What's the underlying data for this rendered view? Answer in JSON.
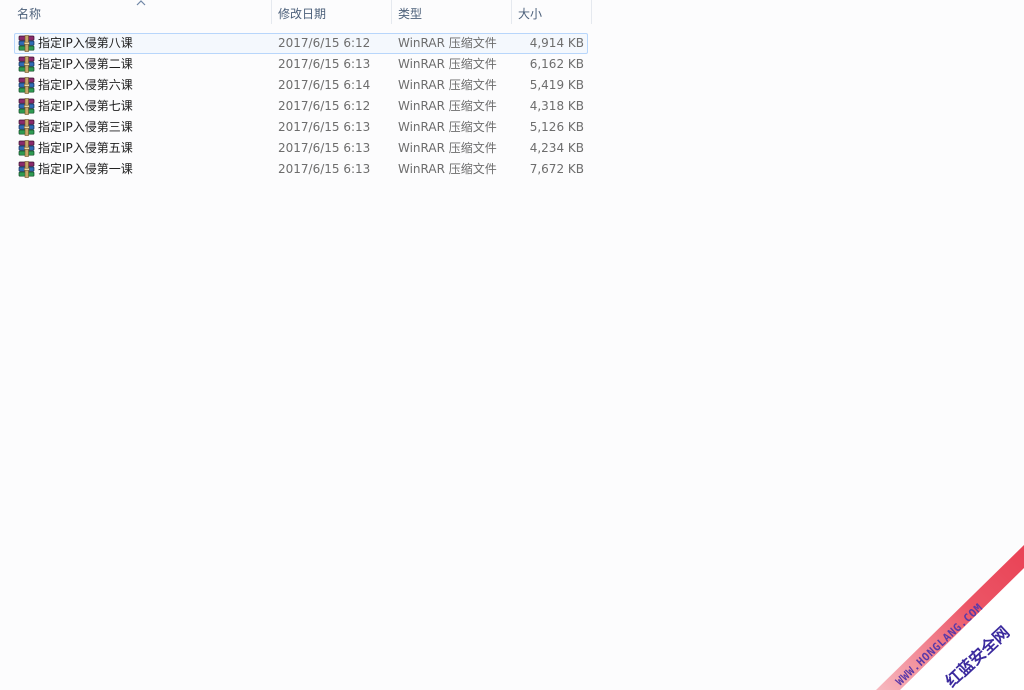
{
  "columns": {
    "name": "名称",
    "date": "修改日期",
    "type": "类型",
    "size": "大小"
  },
  "sort": {
    "column": "name",
    "icon": "sort-ascending-icon"
  },
  "files": [
    {
      "name": "指定IP入侵第八课",
      "date": "2017/6/15 6:12",
      "type": "WinRAR 压缩文件",
      "size": "4,914 KB",
      "selected": true
    },
    {
      "name": "指定IP入侵第二课",
      "date": "2017/6/15 6:13",
      "type": "WinRAR 压缩文件",
      "size": "6,162 KB"
    },
    {
      "name": "指定IP入侵第六课",
      "date": "2017/6/15 6:14",
      "type": "WinRAR 压缩文件",
      "size": "5,419 KB"
    },
    {
      "name": "指定IP入侵第七课",
      "date": "2017/6/15 6:12",
      "type": "WinRAR 压缩文件",
      "size": "4,318 KB"
    },
    {
      "name": "指定IP入侵第三课",
      "date": "2017/6/15 6:13",
      "type": "WinRAR 压缩文件",
      "size": "5,126 KB"
    },
    {
      "name": "指定IP入侵第五课",
      "date": "2017/6/15 6:13",
      "type": "WinRAR 压缩文件",
      "size": "4,234 KB"
    },
    {
      "name": "指定IP入侵第一课",
      "date": "2017/6/15 6:13",
      "type": "WinRAR 压缩文件",
      "size": "7,672 KB"
    }
  ],
  "file_icon": "winrar-archive-icon",
  "watermark": {
    "site": "WWW.HONGLANG.COM",
    "brand": "红蓝安全网",
    "colors": {
      "band": "#e8384c",
      "site_text": "#5b3aa8",
      "brand_text": "#3b2a9e"
    }
  }
}
